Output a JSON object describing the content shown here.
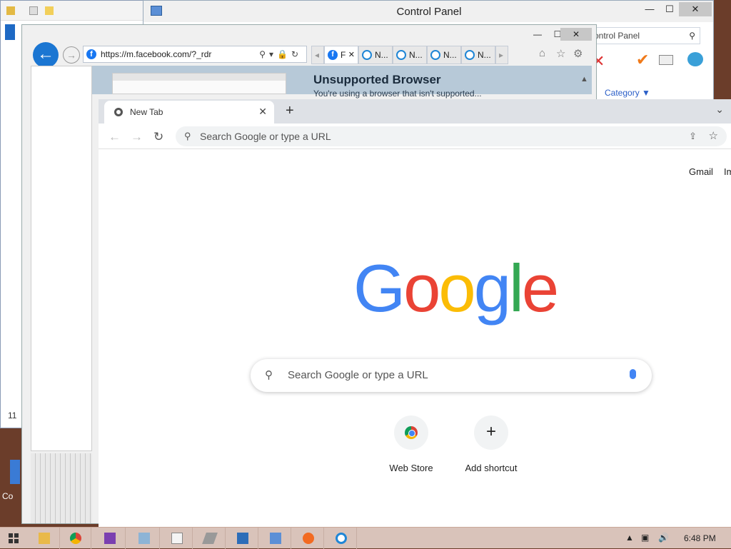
{
  "explorer": {
    "status_count": "11"
  },
  "control_panel": {
    "title": "Control Panel",
    "search_placeholder": "ontrol Panel",
    "category_label": "Category ▼",
    "controls": {
      "minimize": "—",
      "maximize": "☐",
      "close": "✕"
    }
  },
  "ie": {
    "address": "https://m.facebook.com/?_rdr",
    "tabs": [
      {
        "label": "F",
        "icon": "facebook-icon",
        "active": true
      },
      {
        "label": "N...",
        "icon": "ie-icon"
      },
      {
        "label": "N...",
        "icon": "ie-icon"
      },
      {
        "label": "N...",
        "icon": "ie-icon"
      },
      {
        "label": "N...",
        "icon": "ie-icon"
      }
    ],
    "page_heading": "Unsupported Browser",
    "page_subtext": "You're using a browser that isn't supported..."
  },
  "chrome": {
    "tab_title": "New Tab",
    "omnibox_placeholder": "Search Google or type a URL",
    "top_links": {
      "gmail": "Gmail",
      "images": "Im"
    },
    "logo_letters": [
      {
        "ch": "G",
        "color": "#4285F4"
      },
      {
        "ch": "o",
        "color": "#EA4335"
      },
      {
        "ch": "o",
        "color": "#FBBC05"
      },
      {
        "ch": "g",
        "color": "#4285F4"
      },
      {
        "ch": "l",
        "color": "#34A853"
      },
      {
        "ch": "e",
        "color": "#EA4335"
      }
    ],
    "search_placeholder": "Search Google or type a URL",
    "shortcuts": [
      {
        "label": "Web Store",
        "icon": "web-store-icon"
      },
      {
        "label": "Add shortcut",
        "icon": "plus-icon"
      }
    ]
  },
  "desktop": {
    "icon_label": "Co"
  },
  "taskbar": {
    "apps": [
      "file-explorer-icon",
      "chrome-icon",
      "visual-studio-icon",
      "image-viewer-icon",
      "notepad-icon",
      "eraser-icon",
      "remote-desktop-icon",
      "control-panel-icon",
      "firefox-icon",
      "internet-explorer-icon"
    ],
    "clock": "6:48 PM"
  }
}
